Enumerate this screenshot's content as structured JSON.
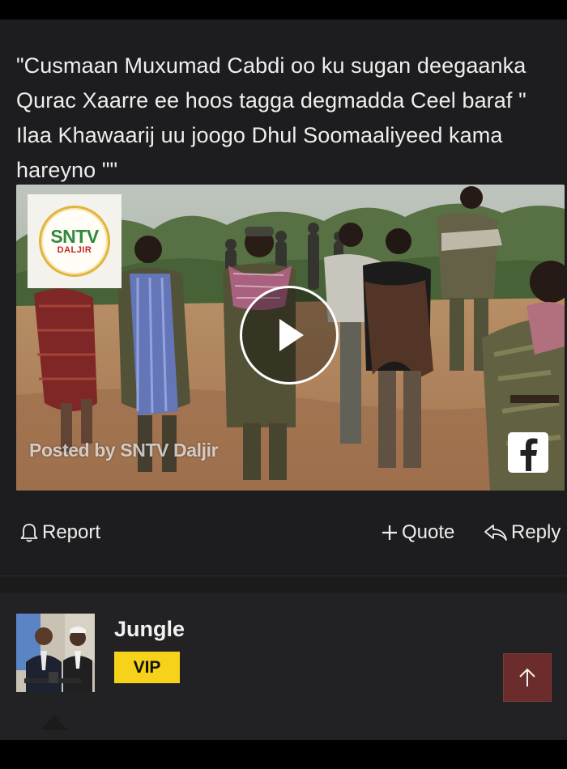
{
  "post": {
    "text": "\"Cusmaan Muxumad Cabdi oo ku sugan deegaanka Qurac Xaarre ee hoos tagga degmadda Ceel baraf \" Ilaa Khawaarij uu joogo Dhul Soomaaliyeed kama hareyno \"\"",
    "video": {
      "channel_logo_main": "SNTV",
      "channel_logo_sub": "DALJIR",
      "posted_by": "Posted by SNTV Daljir",
      "play_icon": "play-icon",
      "platform_icon": "facebook-icon"
    },
    "actions": {
      "report_label": "Report",
      "quote_label": "Quote",
      "reply_label": "Reply"
    }
  },
  "next_post": {
    "username": "Jungle",
    "badge": "VIP"
  },
  "colors": {
    "background": "#1d1d1f",
    "vip_badge": "#f7d21a",
    "scroll_top_button": "#6b2c2b",
    "text": "#eeeeee"
  }
}
